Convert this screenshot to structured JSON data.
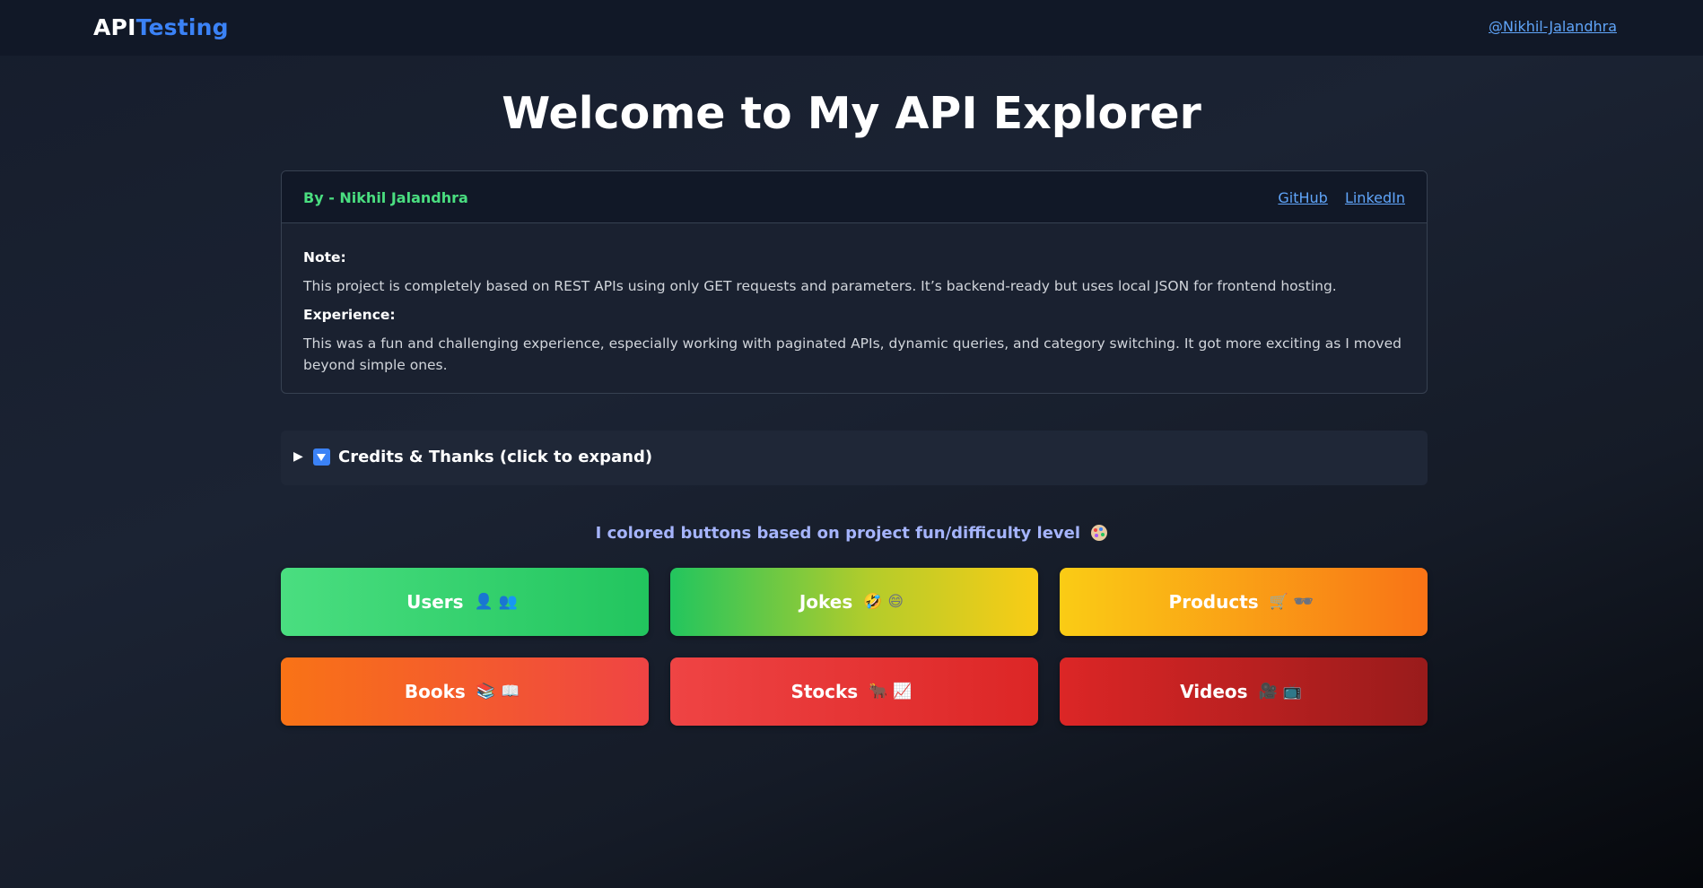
{
  "navbar": {
    "logo_part1": "API",
    "logo_part2": "Testing",
    "profile_link": "@Nikhil-Jalandhra"
  },
  "page_title": "Welcome to My API Explorer",
  "info_card": {
    "author": "By - Nikhil Jalandhra",
    "links": [
      "GitHub",
      "LinkedIn"
    ],
    "note_heading": "Note:",
    "note_text": "This project is completely based on REST APIs using only GET requests and parameters. It’s backend-ready but uses local JSON for frontend hosting.",
    "experience_heading": "Experience:",
    "experience_text": "This was a fun and challenging experience, especially working with paginated APIs, dynamic queries, and category switching. It got more exciting as I moved beyond simple ones."
  },
  "credits": {
    "arrow": "▶",
    "label": "Credits & Thanks (click to expand)",
    "expanded": false
  },
  "hint": "I colored buttons based on project fun/difficulty level",
  "buttons": [
    {
      "label": "Users",
      "emoji": "👤👥",
      "color_from": "#4ade80",
      "color_to": "#22c55e"
    },
    {
      "label": "Jokes",
      "emoji": "🤣😄",
      "color_from": "#22c55e",
      "color_to": "#facc15"
    },
    {
      "label": "Products",
      "emoji": "🛒🕶",
      "color_from": "#facc15",
      "color_to": "#f97316"
    },
    {
      "label": "Books",
      "emoji": "📚📖",
      "color_from": "#f97316",
      "color_to": "#ef4444"
    },
    {
      "label": "Stocks",
      "emoji": "🐂📈",
      "color_from": "#ef4444",
      "color_to": "#dc2626"
    },
    {
      "label": "Videos",
      "emoji": "🎥📺",
      "color_from": "#dc2626",
      "color_to": "#991b1b"
    }
  ],
  "colors": {
    "accent_blue": "#3b82f6",
    "link_blue": "#60a5fa",
    "author_green": "#4ade80",
    "hint_indigo": "#a5b4fc"
  }
}
